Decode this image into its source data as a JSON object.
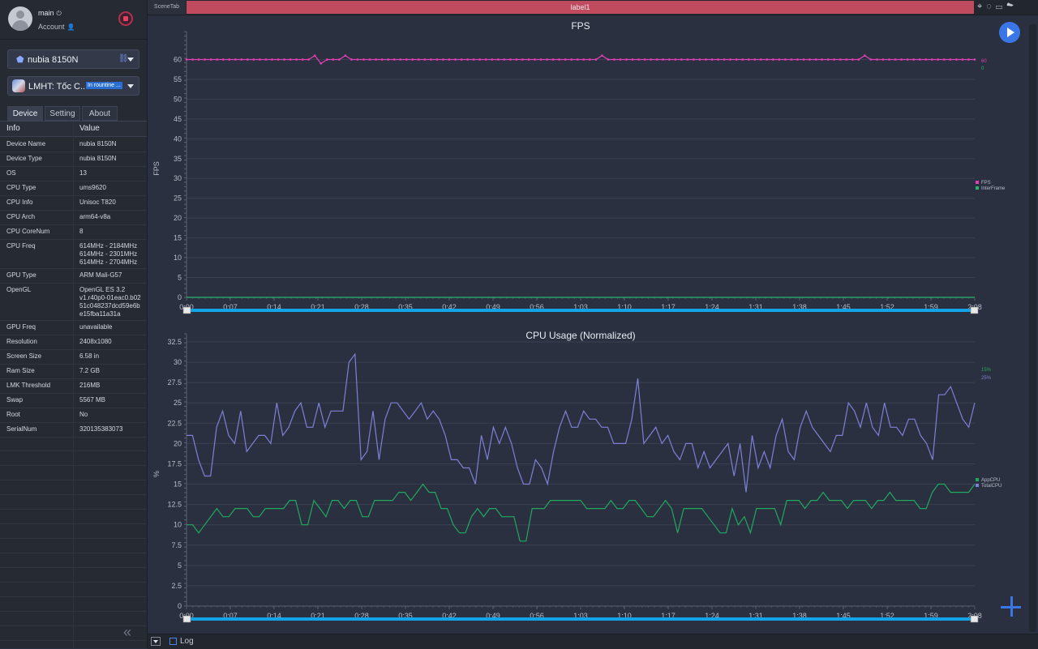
{
  "user": {
    "name": "main",
    "account": "Account"
  },
  "device": {
    "name": "nubia 8150N"
  },
  "app": {
    "name": "LMHT: Tốc C...",
    "status": "In rountine ..."
  },
  "tabs": [
    {
      "label": "Device"
    },
    {
      "label": "Setting"
    },
    {
      "label": "About"
    }
  ],
  "table": {
    "headers": {
      "key": "Info",
      "value": "Value"
    },
    "rows": [
      {
        "key": "Device Name",
        "value": "nubia 8150N"
      },
      {
        "key": "Device Type",
        "value": "nubia 8150N"
      },
      {
        "key": "OS",
        "value": "13"
      },
      {
        "key": "CPU Type",
        "value": "ums9620"
      },
      {
        "key": "CPU Info",
        "value": "Unisoc T820"
      },
      {
        "key": "CPU Arch",
        "value": "arm64-v8a"
      },
      {
        "key": "CPU CoreNum",
        "value": "8"
      },
      {
        "key": "CPU Freq",
        "value": "614MHz - 2184MHz\n614MHz - 2301MHz\n614MHz - 2704MHz"
      },
      {
        "key": "GPU Type",
        "value": "ARM Mali-G57"
      },
      {
        "key": "OpenGL",
        "value": "OpenGL ES 3.2\nv1.r40p0-01eac0.b02\n51c048237dcd59e6b\ne15fba11a31a"
      },
      {
        "key": "GPU Freq",
        "value": "unavailable"
      },
      {
        "key": "Resolution",
        "value": "2408x1080"
      },
      {
        "key": "Screen Size",
        "value": "6.58 in"
      },
      {
        "key": "Ram Size",
        "value": "7.2 GB"
      },
      {
        "key": "LMK Threshold",
        "value": "216MB"
      },
      {
        "key": "Swap",
        "value": "5567 MB"
      },
      {
        "key": "Root",
        "value": "No"
      },
      {
        "key": "SerialNum",
        "value": "320135383073"
      }
    ]
  },
  "tabbar": {
    "scene_tab": "SceneTab",
    "label_tab": "label1"
  },
  "bottom": {
    "log_label": "Log"
  },
  "icons": [
    "user-icon",
    "power-icon",
    "account-icon",
    "stop-icon",
    "android-icon",
    "link-icon",
    "location-icon",
    "bulb-icon",
    "folder-icon",
    "cloud-icon",
    "play-icon",
    "plus-icon",
    "collapse-icon"
  ],
  "colors": {
    "accent": "#3b76e6",
    "label_tab": "#c04a5e",
    "fps": "#e040b4",
    "interframe": "#2ab36a",
    "app_cpu": "#1fa85e",
    "total_cpu": "#7d80d6"
  },
  "chart_data": [
    {
      "type": "line",
      "title": "FPS",
      "ylabel": "FPS",
      "ylim": [
        0,
        65
      ],
      "yticks": [
        0,
        5,
        10,
        15,
        20,
        25,
        30,
        35,
        40,
        45,
        50,
        55,
        60
      ],
      "xticks": [
        "0:00",
        "0:07",
        "0:14",
        "0:21",
        "0:28",
        "0:35",
        "0:42",
        "0:49",
        "0:56",
        "1:03",
        "1:10",
        "1:17",
        "1:24",
        "1:31",
        "1:38",
        "1:45",
        "1:52",
        "1:59",
        "2:08"
      ],
      "series": [
        {
          "name": "FPS",
          "current": "60",
          "values": [
            60,
            60,
            60,
            60,
            60,
            60,
            60,
            60,
            60,
            60,
            60,
            60,
            60,
            60,
            60,
            60,
            60,
            60,
            60,
            60,
            60,
            61,
            59,
            60,
            60,
            60,
            61,
            60,
            60,
            60,
            60,
            60,
            60,
            60,
            60,
            60,
            60,
            60,
            60,
            60,
            60,
            60,
            60,
            60,
            60,
            60,
            60,
            60,
            60,
            60,
            60,
            60,
            60,
            60,
            60,
            60,
            60,
            60,
            60,
            60,
            60,
            60,
            60,
            60,
            60,
            60,
            60,
            60,
            61,
            60,
            60,
            60,
            60,
            60,
            60,
            60,
            60,
            60,
            60,
            60,
            60,
            60,
            60,
            60,
            60,
            60,
            60,
            60,
            60,
            60,
            60,
            60,
            60,
            60,
            60,
            60,
            60,
            60,
            60,
            60,
            60,
            60,
            60,
            60,
            60,
            60,
            60,
            60,
            60,
            60,
            60,
            61,
            60,
            60,
            60,
            60,
            60,
            60,
            60,
            60,
            60,
            60,
            60,
            60,
            60,
            60,
            60,
            60,
            60,
            60
          ]
        },
        {
          "name": "InterFrame",
          "current": "0",
          "values": [
            0,
            0
          ]
        }
      ]
    },
    {
      "type": "line",
      "title": "CPU Usage (Normalized)",
      "ylabel": "%",
      "ylim": [
        0,
        32.5
      ],
      "yticks": [
        0.0,
        2.5,
        5.0,
        7.5,
        10.0,
        12.5,
        15.0,
        17.5,
        20.0,
        22.5,
        25.0,
        27.5,
        30.0,
        32.5
      ],
      "xticks": [
        "0:00",
        "0:07",
        "0:14",
        "0:21",
        "0:28",
        "0:35",
        "0:42",
        "0:49",
        "0:56",
        "1:03",
        "1:10",
        "1:17",
        "1:24",
        "1:31",
        "1:38",
        "1:45",
        "1:52",
        "1:59",
        "2:08"
      ],
      "series": [
        {
          "name": "AppCPU",
          "current": "15%",
          "values": [
            10,
            10,
            9,
            10,
            11,
            12,
            11,
            11,
            12,
            12,
            12,
            11,
            11,
            12,
            12,
            12,
            12,
            13,
            13,
            10,
            10,
            13,
            12,
            11,
            13,
            13,
            12,
            13,
            13,
            11,
            11,
            13,
            13,
            13,
            13,
            14,
            14,
            13,
            14,
            15,
            14,
            14,
            12,
            12,
            10,
            9,
            9,
            11,
            12,
            11,
            12,
            12,
            11,
            11,
            11,
            8,
            8,
            12,
            12,
            12,
            13,
            13,
            13,
            13,
            13,
            13,
            12,
            12,
            12,
            12,
            13,
            12,
            12,
            13,
            13,
            12,
            11,
            11,
            12,
            13,
            12,
            9,
            12,
            12,
            12,
            12,
            11,
            10,
            9,
            9,
            12,
            10,
            11,
            9,
            12,
            12,
            12,
            12,
            10,
            13,
            13,
            13,
            12,
            13,
            13,
            14,
            13,
            13,
            13,
            12,
            13,
            13,
            13,
            12,
            13,
            13,
            14,
            13,
            13,
            13,
            13,
            12,
            12,
            14,
            15,
            15,
            14,
            14,
            14,
            14,
            15
          ]
        },
        {
          "name": "TotalCPU",
          "current": "25%",
          "values": [
            21,
            21,
            18,
            16,
            16,
            22,
            24,
            21,
            20,
            24,
            19,
            20,
            21,
            21,
            20,
            25,
            21,
            22,
            24,
            25,
            22,
            22,
            25,
            22,
            24,
            24,
            24,
            30,
            31,
            18,
            19,
            24,
            18,
            23,
            25,
            25,
            24,
            23,
            24,
            25,
            23,
            24,
            23,
            21,
            18,
            18,
            17,
            17,
            15,
            21,
            18,
            22,
            20,
            22,
            20,
            17,
            15,
            15,
            18,
            17,
            15,
            19,
            22,
            24,
            22,
            22,
            24,
            23,
            23,
            22,
            22,
            20,
            20,
            20,
            23,
            28,
            20,
            21,
            22,
            20,
            21,
            19,
            18,
            20,
            20,
            17,
            19,
            17,
            18,
            19,
            20,
            16,
            20,
            14,
            21,
            17,
            19,
            17,
            21,
            23,
            19,
            18,
            22,
            24,
            22,
            21,
            20,
            19,
            21,
            21,
            25,
            24,
            22,
            25,
            22,
            21,
            25,
            22,
            22,
            21,
            23,
            23,
            21,
            20,
            18,
            26,
            26,
            27,
            25,
            23,
            22,
            25
          ]
        }
      ]
    }
  ]
}
